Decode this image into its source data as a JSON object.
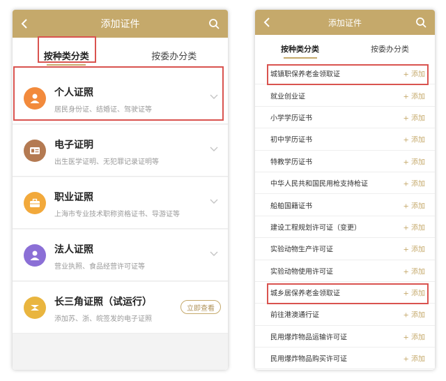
{
  "left_screen": {
    "header_title": "添加证件",
    "tabs": [
      "按种类分类",
      "按委办分类"
    ],
    "categories": [
      {
        "title": "个人证照",
        "subtitle": "居民身份证、结婚证、驾驶证等",
        "icon": "person-icon",
        "color": "#f28a3c"
      },
      {
        "title": "电子证明",
        "subtitle": "出生医学证明、无犯罪记录证明等",
        "icon": "id-card-icon",
        "color": "#b47a52"
      },
      {
        "title": "职业证照",
        "subtitle": "上海市专业技术职称资格证书、导游证等",
        "icon": "briefcase-icon",
        "color": "#f2a93b"
      },
      {
        "title": "法人证照",
        "subtitle": "营业执照、食品经营许可证等",
        "icon": "company-icon",
        "color": "#8b6fd6"
      },
      {
        "title": "长三角证照（试运行）",
        "subtitle": "添加苏、浙、皖签发的电子证照",
        "icon": "yrd-icon",
        "color": "#e9b53f",
        "action": "立即查看"
      }
    ]
  },
  "right_screen": {
    "header_title": "添加证件",
    "tabs": [
      "按种类分类",
      "按委办分类"
    ],
    "add_label": "+ 添加",
    "items": [
      "城镇职保养老金领取证",
      "就业创业证",
      "小学学历证书",
      "初中学历证书",
      "特教学历证书",
      "中华人民共和国民用枪支持枪证",
      "船舶国籍证书",
      "建设工程规划许可证（变更）",
      "实验动物生产许可证",
      "实验动物使用许可证",
      "城乡居保养老金领取证",
      "前往港澳通行证",
      "民用爆炸物品运输许可证",
      "民用爆炸物品购买许可证"
    ]
  },
  "colors": {
    "accent": "#c5a96b",
    "highlight": "#d9534f"
  }
}
